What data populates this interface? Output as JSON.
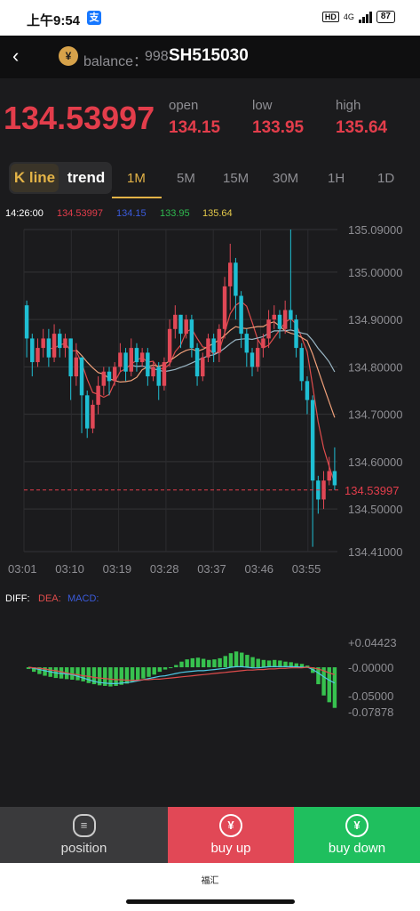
{
  "status_bar": {
    "time": "上午9:54",
    "app_icon": "alipay-icon",
    "hd": "HD",
    "network": "4G",
    "battery": "87"
  },
  "header": {
    "balance_label": "balance：",
    "balance_value": "998",
    "symbol": "SH515030"
  },
  "quote": {
    "last_price": "134.53997",
    "open_label": "open",
    "open_value": "134.15",
    "low_label": "low",
    "low_value": "133.95",
    "high_label": "high",
    "high_value": "135.64"
  },
  "tabs": {
    "kline_label": "K line",
    "trend_label": "trend",
    "timeframes": [
      "1M",
      "5M",
      "15M",
      "30M",
      "1H",
      "1D"
    ],
    "active_timeframe": "1M"
  },
  "info_line": {
    "time": "14:26:00",
    "values": [
      "134.53997",
      "134.15",
      "133.95",
      "135.64"
    ],
    "colors": [
      "#e33d4b",
      "#3b5bdb",
      "#2fb84f",
      "#e3c84a"
    ]
  },
  "macd_legend": {
    "diff": "DIFF:",
    "dea": "DEA:",
    "macd": "MACD:"
  },
  "colors": {
    "up": "#e14856",
    "down": "#1fbfd3",
    "accent": "#e3b347",
    "ma1": "#f0a07a",
    "ma2": "#e04c4c",
    "ma3": "#9ab6c4",
    "macd_pos": "#37c24f",
    "dif": "#4fc9e6",
    "dea": "#e04c4c"
  },
  "chart_data": [
    {
      "type": "candlestick",
      "x_ticks": [
        "03:01",
        "03:10",
        "03:19",
        "03:28",
        "03:37",
        "03:46",
        "03:55"
      ],
      "y_ticks": [
        "135.09000",
        "135.00000",
        "134.90000",
        "134.80000",
        "134.70000",
        "134.60000",
        "134.50000",
        "134.41000"
      ],
      "ylim": [
        134.41,
        135.09
      ],
      "last_price_label": "134.53997",
      "last_price": 134.53997,
      "candles": [
        [
          134.93,
          134.86,
          134.94,
          134.82
        ],
        [
          134.86,
          134.81,
          134.87,
          134.78
        ],
        [
          134.81,
          134.84,
          134.86,
          134.8
        ],
        [
          134.84,
          134.86,
          134.88,
          134.82
        ],
        [
          134.86,
          134.82,
          134.88,
          134.8
        ],
        [
          134.82,
          134.87,
          134.89,
          134.81
        ],
        [
          134.87,
          134.84,
          134.88,
          134.82
        ],
        [
          134.84,
          134.86,
          134.87,
          134.82
        ],
        [
          134.86,
          134.78,
          134.86,
          134.73
        ],
        [
          134.78,
          134.82,
          134.85,
          134.76
        ],
        [
          134.82,
          134.74,
          134.82,
          134.66
        ],
        [
          134.74,
          134.67,
          134.75,
          134.65
        ],
        [
          134.67,
          134.72,
          134.73,
          134.66
        ],
        [
          134.72,
          134.76,
          134.78,
          134.7
        ],
        [
          134.76,
          134.79,
          134.8,
          134.74
        ],
        [
          134.79,
          134.77,
          134.8,
          134.74
        ],
        [
          134.77,
          134.8,
          134.81,
          134.76
        ],
        [
          134.8,
          134.83,
          134.85,
          134.79
        ],
        [
          134.83,
          134.79,
          134.84,
          134.77
        ],
        [
          134.79,
          134.84,
          134.86,
          134.78
        ],
        [
          134.84,
          134.81,
          134.85,
          134.79
        ],
        [
          134.81,
          134.83,
          134.84,
          134.8
        ],
        [
          134.83,
          134.78,
          134.84,
          134.76
        ],
        [
          134.78,
          134.8,
          134.81,
          134.77
        ],
        [
          134.8,
          134.76,
          134.81,
          134.73
        ],
        [
          134.76,
          134.81,
          134.82,
          134.75
        ],
        [
          134.81,
          134.88,
          134.9,
          134.8
        ],
        [
          134.88,
          134.91,
          134.93,
          134.86
        ],
        [
          134.91,
          134.87,
          134.91,
          134.84
        ],
        [
          134.87,
          134.9,
          134.91,
          134.86
        ],
        [
          134.9,
          134.84,
          134.91,
          134.82
        ],
        [
          134.84,
          134.78,
          134.85,
          134.76
        ],
        [
          134.78,
          134.82,
          134.83,
          134.77
        ],
        [
          134.82,
          134.86,
          134.87,
          134.81
        ],
        [
          134.86,
          134.83,
          134.87,
          134.81
        ],
        [
          134.83,
          134.88,
          134.89,
          134.81
        ],
        [
          134.88,
          134.97,
          134.99,
          134.86
        ],
        [
          134.97,
          135.02,
          135.06,
          134.92
        ],
        [
          135.02,
          134.95,
          135.03,
          134.9
        ],
        [
          134.95,
          134.87,
          134.96,
          134.84
        ],
        [
          134.87,
          134.83,
          134.88,
          134.8
        ],
        [
          134.83,
          134.8,
          134.84,
          134.78
        ],
        [
          134.8,
          134.84,
          134.86,
          134.79
        ],
        [
          134.84,
          134.86,
          134.87,
          134.82
        ],
        [
          134.86,
          134.9,
          134.92,
          134.84
        ],
        [
          134.9,
          134.91,
          134.93,
          134.88
        ],
        [
          134.91,
          134.88,
          134.92,
          134.86
        ],
        [
          134.88,
          134.92,
          134.94,
          134.87
        ],
        [
          134.92,
          134.9,
          135.09,
          134.88
        ],
        [
          134.9,
          134.84,
          134.91,
          134.82
        ],
        [
          134.84,
          134.77,
          134.85,
          134.75
        ],
        [
          134.77,
          134.73,
          134.78,
          134.7
        ],
        [
          134.73,
          134.56,
          134.74,
          134.42
        ],
        [
          134.56,
          134.52,
          134.57,
          134.49
        ],
        [
          134.52,
          134.56,
          134.58,
          134.5
        ],
        [
          134.56,
          134.58,
          134.61,
          134.55
        ],
        [
          134.58,
          134.55,
          134.63,
          134.54
        ]
      ]
    },
    {
      "type": "macd",
      "y_ticks": [
        "+0.04423",
        "-0.00000",
        "-0.05000",
        "-0.07878"
      ],
      "ylim": [
        -0.07878,
        0.04423
      ],
      "hist": [
        -0.003,
        -0.008,
        -0.012,
        -0.015,
        -0.017,
        -0.019,
        -0.02,
        -0.021,
        -0.022,
        -0.023,
        -0.025,
        -0.028,
        -0.03,
        -0.032,
        -0.033,
        -0.034,
        -0.033,
        -0.031,
        -0.029,
        -0.026,
        -0.023,
        -0.02,
        -0.017,
        -0.013,
        -0.008,
        -0.004,
        -0.001,
        0.004,
        0.01,
        0.014,
        0.016,
        0.017,
        0.015,
        0.013,
        0.014,
        0.016,
        0.02,
        0.025,
        0.028,
        0.026,
        0.022,
        0.018,
        0.015,
        0.013,
        0.012,
        0.013,
        0.012,
        0.01,
        0.009,
        0.007,
        0.006,
        0.003,
        -0.01,
        -0.03,
        -0.05,
        -0.062,
        -0.072
      ],
      "dif": [
        0.0,
        -0.002,
        -0.004,
        -0.006,
        -0.008,
        -0.01,
        -0.011,
        -0.012,
        -0.013,
        -0.016,
        -0.019,
        -0.022,
        -0.025,
        -0.027,
        -0.028,
        -0.029,
        -0.029,
        -0.028,
        -0.027,
        -0.026,
        -0.024,
        -0.022,
        -0.02,
        -0.018,
        -0.016,
        -0.015,
        -0.013,
        -0.011,
        -0.009,
        -0.008,
        -0.007,
        -0.006,
        -0.006,
        -0.005,
        -0.004,
        -0.003,
        -0.002,
        0.0,
        0.001,
        0.001,
        0.0,
        -0.001,
        -0.001,
        0.0,
        0.001,
        0.001,
        0.001,
        0.001,
        0.001,
        0.001,
        0.0,
        0.0,
        -0.004,
        -0.01,
        -0.017,
        -0.023,
        -0.028
      ],
      "dea": [
        0.0,
        -0.001,
        -0.002,
        -0.003,
        -0.005,
        -0.006,
        -0.008,
        -0.01,
        -0.012,
        -0.013,
        -0.015,
        -0.016,
        -0.018,
        -0.019,
        -0.02,
        -0.021,
        -0.022,
        -0.022,
        -0.023,
        -0.023,
        -0.023,
        -0.022,
        -0.022,
        -0.021,
        -0.021,
        -0.02,
        -0.019,
        -0.018,
        -0.017,
        -0.016,
        -0.015,
        -0.014,
        -0.013,
        -0.012,
        -0.011,
        -0.01,
        -0.009,
        -0.008,
        -0.007,
        -0.006,
        -0.005,
        -0.005,
        -0.004,
        -0.004,
        -0.003,
        -0.003,
        -0.002,
        -0.002,
        -0.001,
        -0.001,
        -0.001,
        0.0,
        -0.001,
        -0.003,
        -0.006,
        -0.01,
        -0.013
      ]
    }
  ],
  "bottom_bar": {
    "position_label": "position",
    "buy_up_label": "buy up",
    "buy_down_label": "buy down"
  },
  "footer": {
    "brand": "福汇"
  }
}
